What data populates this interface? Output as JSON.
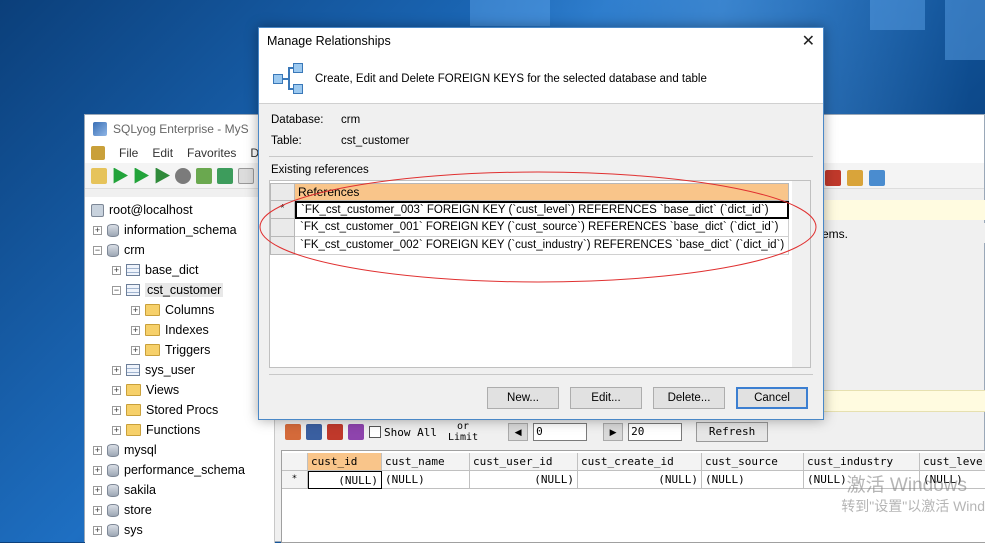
{
  "app": {
    "title": "SQLyog Enterprise - MyS",
    "menu": [
      "File",
      "Edit",
      "Favorites",
      "D"
    ]
  },
  "tree": [
    {
      "label": "root@localhost",
      "icon": "server-icon",
      "expander": ""
    },
    {
      "label": "information_schema",
      "icon": "database-icon",
      "expander": "+"
    },
    {
      "label": "crm",
      "icon": "database-icon",
      "expander": "−"
    },
    {
      "label": "base_dict",
      "icon": "table-icon",
      "expander": "+"
    },
    {
      "label": "cst_customer",
      "icon": "table-icon",
      "expander": "−"
    },
    {
      "label": "Columns",
      "icon": "folder-icon",
      "expander": "+"
    },
    {
      "label": "Indexes",
      "icon": "folder-icon",
      "expander": "+"
    },
    {
      "label": "Triggers",
      "icon": "folder-icon",
      "expander": "+"
    },
    {
      "label": "sys_user",
      "icon": "table-icon",
      "expander": "+"
    },
    {
      "label": "Views",
      "icon": "folder-icon",
      "expander": "+"
    },
    {
      "label": "Stored Procs",
      "icon": "folder-icon",
      "expander": "+"
    },
    {
      "label": "Functions",
      "icon": "folder-icon",
      "expander": "+"
    },
    {
      "label": "mysql",
      "icon": "database-icon",
      "expander": "+"
    },
    {
      "label": "performance_schema",
      "icon": "database-icon",
      "expander": "+"
    },
    {
      "label": "sakila",
      "icon": "database-icon",
      "expander": "+"
    },
    {
      "label": "store",
      "icon": "database-icon",
      "expander": "+"
    },
    {
      "label": "sys",
      "icon": "database-icon",
      "expander": "+"
    }
  ],
  "right_panel": {
    "items_text": "ems."
  },
  "grid_toolbar": {
    "show_all": "Show All",
    "or_text": "or",
    "limit_text": "Limit",
    "offset": "0",
    "count": "20",
    "refresh": "Refresh"
  },
  "result_grid": {
    "columns": [
      "cust_id",
      "cust_name",
      "cust_user_id",
      "cust_create_id",
      "cust_source",
      "cust_industry",
      "cust_leve"
    ],
    "row_marker": "*",
    "row": [
      "(NULL)",
      "(NULL)",
      "(NULL)",
      "(NULL)",
      "(NULL)",
      "(NULL)",
      "(NULL)"
    ]
  },
  "watermark": {
    "line1": "激活 Windows",
    "line2": "转到\"设置\"以激活 Wind"
  },
  "dialog": {
    "title": "Manage Relationships",
    "close": "✕",
    "banner": "Create, Edit and Delete FOREIGN KEYS for the selected database and table",
    "database_label": "Database:",
    "database_value": "crm",
    "table_label": "Table:",
    "table_value": "cst_customer",
    "existing_label": "Existing references",
    "refs_header": "References",
    "refs": [
      {
        "marker": "*",
        "text": "`FK_cst_customer_003` FOREIGN KEY (`cust_level`) REFERENCES `base_dict` (`dict_id`)"
      },
      {
        "marker": "",
        "text": "`FK_cst_customer_001` FOREIGN KEY (`cust_source`) REFERENCES `base_dict` (`dict_id`)"
      },
      {
        "marker": "",
        "text": "`FK_cst_customer_002` FOREIGN KEY (`cust_industry`) REFERENCES `base_dict` (`dict_id`)"
      }
    ],
    "buttons": {
      "new": "New...",
      "edit": "Edit...",
      "delete": "Delete...",
      "cancel": "Cancel"
    }
  }
}
